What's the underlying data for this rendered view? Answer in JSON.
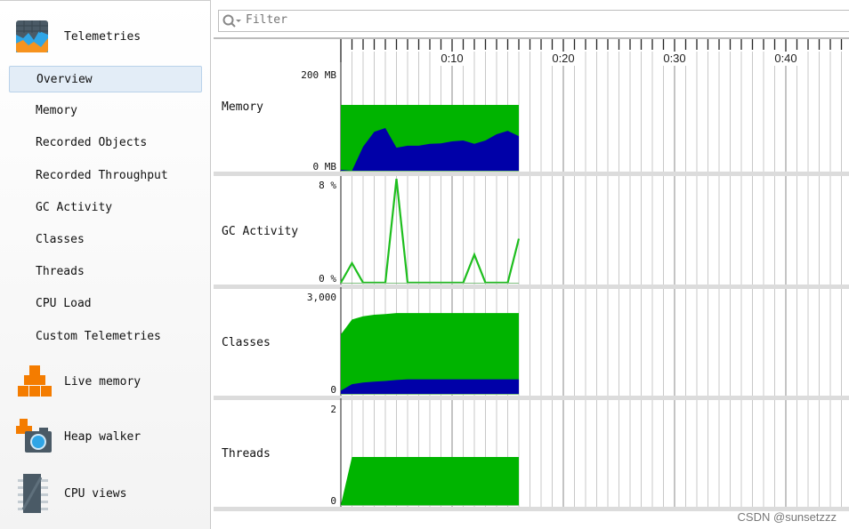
{
  "sidebar": {
    "telemetries": {
      "label": "Telemetries",
      "icon": "telemetries-chart-icon"
    },
    "items": [
      {
        "label": "Overview",
        "selected": true
      },
      {
        "label": "Memory"
      },
      {
        "label": "Recorded Objects"
      },
      {
        "label": "Recorded Throughput"
      },
      {
        "label": "GC Activity"
      },
      {
        "label": "Classes"
      },
      {
        "label": "Threads"
      },
      {
        "label": "CPU Load"
      },
      {
        "label": "Custom Telemetries"
      }
    ],
    "groups": [
      {
        "label": "Live memory",
        "icon": "cubes-icon"
      },
      {
        "label": "Heap walker",
        "icon": "camera-icon"
      },
      {
        "label": "CPU views",
        "icon": "chip-icon"
      }
    ]
  },
  "filter": {
    "placeholder": "Filter",
    "value": ""
  },
  "watermark": "CSDN @sunsetzzz",
  "colors": {
    "allocated": "#00b400",
    "used": "#0000a8",
    "gc": "#1ebe1e",
    "accent": "#e3edf7"
  },
  "chart_data": {
    "type": "area",
    "x_unit": "seconds",
    "time_ticks": [
      "0:10",
      "0:20",
      "0:30",
      "0:40"
    ],
    "x_range": [
      0,
      45
    ],
    "grid": true,
    "panels": [
      {
        "name": "Memory",
        "ymax_label": "200 MB",
        "ymin_label": "0 MB",
        "ylim": [
          0,
          200
        ],
        "kind": "area",
        "series": [
          {
            "role": "allocated",
            "values": [
              137,
              137,
              137,
              137,
              137,
              137,
              137,
              137,
              137,
              137,
              137,
              137,
              137,
              137,
              137,
              137,
              137
            ]
          },
          {
            "role": "used",
            "values": [
              2,
              0,
              50,
              81,
              89,
              48,
              52,
              52,
              56,
              57,
              61,
              63,
              56,
              63,
              76,
              83,
              72
            ]
          }
        ]
      },
      {
        "name": "GC Activity",
        "ymax_label": "8 %",
        "ymin_label": "0 %",
        "ylim": [
          0,
          8
        ],
        "kind": "line",
        "series": [
          {
            "role": "gc",
            "values": [
              0,
              1.6,
              0,
              0,
              0,
              8.5,
              0,
              0,
              0,
              0,
              0,
              0,
              2.3,
              0,
              0,
              0,
              3.6
            ]
          }
        ]
      },
      {
        "name": "Classes",
        "ymax_label": "3,000",
        "ymin_label": "0",
        "ylim": [
          0,
          3000
        ],
        "kind": "area",
        "series": [
          {
            "role": "allocated",
            "values": [
              1840,
              2300,
              2400,
              2450,
              2470,
              2500,
              2500,
              2500,
              2500,
              2500,
              2500,
              2500,
              2500,
              2500,
              2500,
              2500,
              2500
            ]
          },
          {
            "role": "used",
            "values": [
              100,
              300,
              350,
              380,
              400,
              430,
              450,
              450,
              450,
              450,
              450,
              450,
              450,
              450,
              450,
              450,
              450
            ]
          }
        ]
      },
      {
        "name": "Threads",
        "ymax_label": "2",
        "ymin_label": "0",
        "ylim": [
          0,
          2
        ],
        "kind": "area",
        "series": [
          {
            "role": "allocated",
            "values": [
              0,
              1,
              1,
              1,
              1,
              1,
              1,
              1,
              1,
              1,
              1,
              1,
              1,
              1,
              1,
              1,
              1
            ]
          }
        ]
      }
    ]
  }
}
